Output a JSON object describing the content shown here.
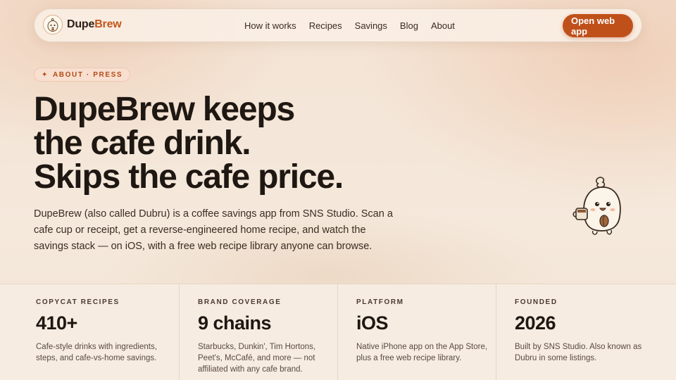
{
  "brand": {
    "name_part1": "Dupe",
    "name_part2": "Brew"
  },
  "nav": {
    "links": [
      "How it works",
      "Recipes",
      "Savings",
      "Blog",
      "About"
    ],
    "cta": "Open web app"
  },
  "hero": {
    "badge_icon": "sparkle-icon",
    "badge": "ABOUT · PRESS",
    "headline": [
      "DupeBrew keeps",
      "the cafe drink.",
      "Skips the cafe price."
    ],
    "lede": "DupeBrew (also called Dubru) is a coffee savings app from SNS Studio. Scan a cafe cup or receipt, get a reverse-engineered home recipe, and watch the savings stack — on iOS, with a free web recipe library anyone can browse."
  },
  "stats": [
    {
      "label": "COPYCAT RECIPES",
      "value": "410+",
      "desc": "Cafe-style drinks with ingredients, steps, and cafe-vs-home savings."
    },
    {
      "label": "BRAND COVERAGE",
      "value": "9 chains",
      "desc": "Starbucks, Dunkin', Tim Hortons, Peet's, McCafé, and more — not affiliated with any cafe brand."
    },
    {
      "label": "PLATFORM",
      "value": "iOS",
      "desc": "Native iPhone app on the App Store, plus a free web recipe library."
    },
    {
      "label": "FOUNDED",
      "value": "2026",
      "desc": "Built by SNS Studio. Also known as Dubru in some listings."
    }
  ],
  "colors": {
    "accent": "#c0501a",
    "accent_text": "#c0561c",
    "background": "#f5ebdf",
    "text": "#1e1712"
  }
}
